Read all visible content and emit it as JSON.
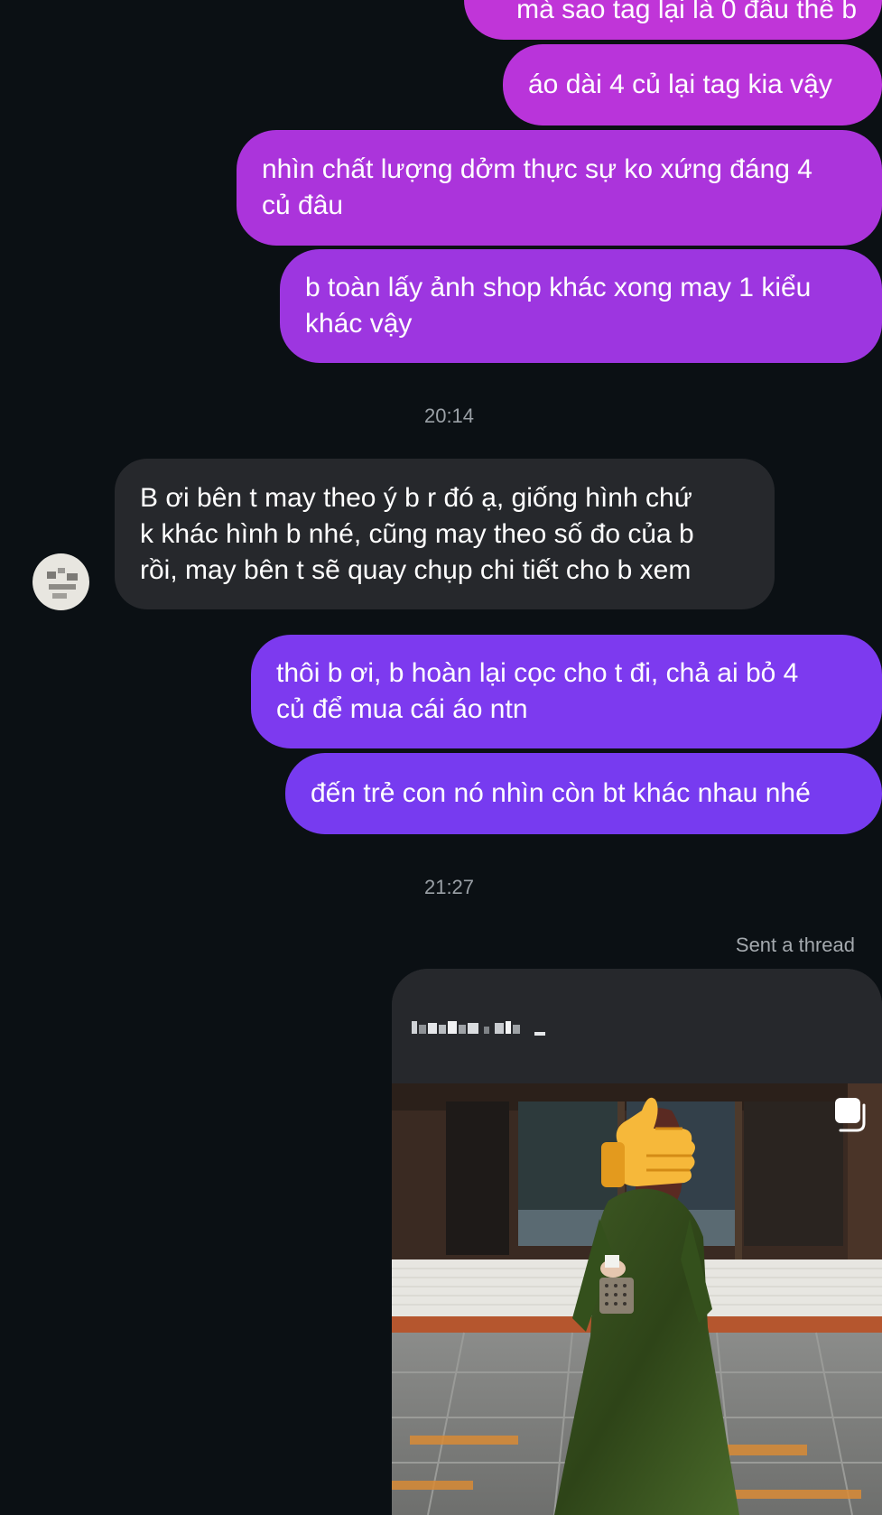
{
  "messages": {
    "m0": "mà sao tag lại là 0 đâu thế b",
    "m1": "áo dài 4 củ lại tag kia vậy",
    "m2_line1": "nhìn chất lượng dởm thực sự ko xứng đáng 4",
    "m2_line2": "củ đâu",
    "m3_line1": "b toàn lấy ảnh shop khác xong may 1 kiểu",
    "m3_line2": "khác vậy",
    "time1": "20:14",
    "in1_line1": "B ơi bên t may theo ý b r đó ạ, giống hình chứ",
    "in1_line2": "k khác hình b nhé, cũng may theo số đo của b",
    "in1_line3": "rồi, may bên t sẽ quay chụp chi tiết cho b xem",
    "m4_line1": "thôi b ơi, b hoàn lại cọc cho t đi, chả ai bỏ 4",
    "m4_line2": "củ để mua cái áo ntn",
    "m5": "đến trẻ con nó nhìn còn bt khác nhau nhé",
    "time2": "21:27",
    "sent_label": "Sent a thread"
  },
  "thread_card": {
    "icon": "multi-image-icon",
    "photo_overlay": "thumbs-up-emoji"
  },
  "colors": {
    "background": "#0b1014",
    "incoming_bubble": "#26282c",
    "outgoing_magenta": "#b233d9",
    "outgoing_violet": "#7b3bf0",
    "timestamp": "#9aa0a6"
  }
}
